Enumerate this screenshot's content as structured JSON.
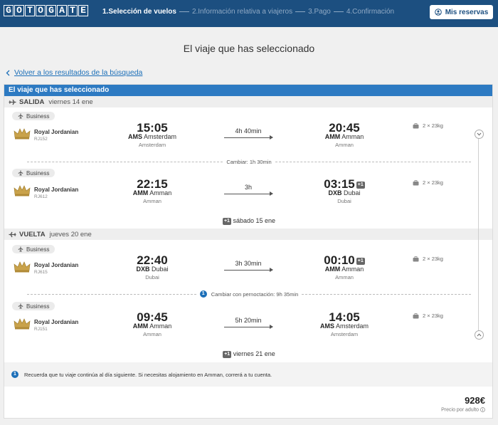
{
  "brand": {
    "logo_letters": [
      "G",
      "O",
      "T",
      "O",
      "G",
      "A",
      "T",
      "E"
    ]
  },
  "steps": [
    {
      "label": "1.Selección de vuelos",
      "active": true
    },
    {
      "label": "2.Información relativa a viajeros",
      "active": false
    },
    {
      "label": "3.Pago",
      "active": false
    },
    {
      "label": "4.Confirmación",
      "active": false
    }
  ],
  "header": {
    "my_bookings_label": "Mis reservas",
    "my_bookings_icon": "user-circle-icon"
  },
  "page": {
    "title": "El viaje que has seleccionado",
    "back_link": "Volver a los resultados de la búsqueda"
  },
  "panel": {
    "title": "El viaje que has seleccionado",
    "outbound": {
      "label": "SALIDA",
      "date": "viernes 14 ene",
      "segments": [
        {
          "cabin": "Business",
          "airline": "Royal Jordanian",
          "flight": "RJ152",
          "dep_time": "15:05",
          "dep_code": "AMS",
          "dep_airport": "Amsterdam",
          "dep_city": "Amsterdam",
          "duration": "4h 40min",
          "arr_time": "20:45",
          "arr_code": "AMM",
          "arr_airport": "Amman",
          "arr_city": "Amman",
          "arr_plus": "",
          "baggage": "2 × 23kg"
        },
        {
          "cabin": "Business",
          "airline": "Royal Jordanian",
          "flight": "RJ612",
          "dep_time": "22:15",
          "dep_code": "AMM",
          "dep_airport": "Amman",
          "dep_city": "Amman",
          "duration": "3h",
          "arr_time": "03:15",
          "arr_code": "DXB",
          "arr_airport": "Dubai",
          "arr_city": "Dubai",
          "arr_plus": "+1",
          "baggage": "2 × 23kg"
        }
      ],
      "layover": "Cambiar: 1h 30min",
      "arrival_badge": "+1",
      "arrival_date": "sábado 15 ene"
    },
    "return": {
      "label": "VUELTA",
      "date": "jueves 20 ene",
      "segments": [
        {
          "cabin": "Business",
          "airline": "Royal Jordanian",
          "flight": "RJ615",
          "dep_time": "22:40",
          "dep_code": "DXB",
          "dep_airport": "Dubai",
          "dep_city": "Dubai",
          "duration": "3h 30min",
          "arr_time": "00:10",
          "arr_code": "AMM",
          "arr_airport": "Amman",
          "arr_city": "Amman",
          "arr_plus": "+1",
          "baggage": "2 × 23kg"
        },
        {
          "cabin": "Business",
          "airline": "Royal Jordanian",
          "flight": "RJ151",
          "dep_time": "09:45",
          "dep_code": "AMM",
          "dep_airport": "Amman",
          "dep_city": "Amman",
          "duration": "5h 20min",
          "arr_time": "14:05",
          "arr_code": "AMS",
          "arr_airport": "Amsterdam",
          "arr_city": "Amsterdam",
          "arr_plus": "",
          "baggage": "2 × 23kg"
        }
      ],
      "layover_num": "1",
      "layover": "Cambiar con pernoctación: 9h 35min",
      "arrival_badge": "+1",
      "arrival_date": "viernes 21 ene"
    },
    "notice_num": "1",
    "notice": "Recuerda que tu viaje continúa al día siguiente. Si necesitas alojamiento en Amman, correrá a tu cuenta.",
    "price": "928€",
    "price_label": "Precio por adulto"
  },
  "colors": {
    "header_bg": "#1c4f80",
    "panel_head": "#2d7ac2",
    "link": "#1c6fb8"
  }
}
